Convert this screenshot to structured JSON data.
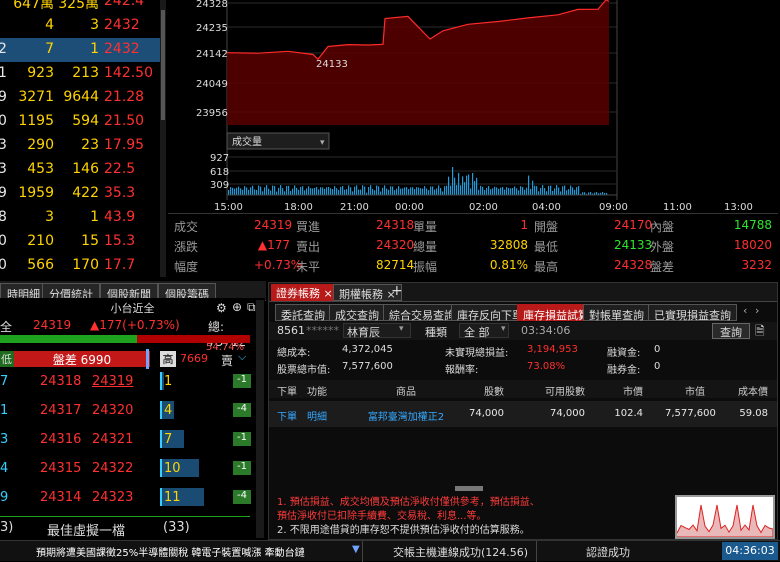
{
  "quotes": {
    "rows": [
      [
        "647萬",
        "325萬",
        "242.4"
      ],
      [
        "4",
        "3",
        "2432"
      ],
      [
        "7",
        "1",
        "2432"
      ],
      [
        "923",
        "213",
        "142.50"
      ],
      [
        "3271",
        "9644",
        "21.28"
      ],
      [
        "1195",
        "594",
        "21.50"
      ],
      [
        "290",
        "23",
        "17.95"
      ],
      [
        "453",
        "146",
        "22.5"
      ],
      [
        "1959",
        "422",
        "35.3"
      ],
      [
        "3",
        "1",
        "43.9"
      ],
      [
        "210",
        "15",
        "15.3"
      ],
      [
        "566",
        "170",
        "17.7"
      ]
    ],
    "prefix": [
      "",
      "",
      "2",
      "1",
      "9",
      "0",
      "3",
      "3",
      "9",
      "8",
      "0",
      "0"
    ],
    "selected_index": 2
  },
  "chart": {
    "y_ticks": [
      "24328",
      "24235",
      "24142",
      "24049",
      "23956"
    ],
    "low_label": "24133",
    "volume_select": "成交量",
    "vol_ticks": [
      "927",
      "618",
      "309"
    ],
    "x_ticks": [
      "15:00",
      "18:00",
      "21:00",
      "00:00",
      "02:00",
      "04:00",
      "09:00",
      "11:00",
      "13:00"
    ]
  },
  "stats": {
    "rows": [
      [
        {
          "t": "成交",
          "c": "gray"
        },
        {
          "t": "24319",
          "c": "r"
        },
        {
          "t": "買進",
          "c": "gray"
        },
        {
          "t": "24318",
          "c": "r"
        },
        {
          "t": "單量",
          "c": "gray"
        },
        {
          "t": "1",
          "c": "r"
        },
        {
          "t": "開盤",
          "c": "gray"
        },
        {
          "t": "24170",
          "c": "r"
        },
        {
          "t": "內盤",
          "c": "gray"
        },
        {
          "t": "14788",
          "c": "g"
        }
      ],
      [
        {
          "t": "漲跌",
          "c": "gray"
        },
        {
          "t": "▲177",
          "c": "r"
        },
        {
          "t": "賣出",
          "c": "gray"
        },
        {
          "t": "24320",
          "c": "r"
        },
        {
          "t": "總量",
          "c": "gray"
        },
        {
          "t": "32808",
          "c": "y"
        },
        {
          "t": "最低",
          "c": "gray"
        },
        {
          "t": "24133",
          "c": "g"
        },
        {
          "t": "外盤",
          "c": "gray"
        },
        {
          "t": "18020",
          "c": "r"
        }
      ],
      [
        {
          "t": "幅度",
          "c": "gray"
        },
        {
          "t": "+0.73%",
          "c": "r"
        },
        {
          "t": "未平",
          "c": "gray"
        },
        {
          "t": "82714",
          "c": "y"
        },
        {
          "t": "振幅",
          "c": "gray"
        },
        {
          "t": "0.81%",
          "c": "y"
        },
        {
          "t": "最高",
          "c": "gray"
        },
        {
          "t": "24328",
          "c": "r"
        },
        {
          "t": "盤差",
          "c": "gray"
        },
        {
          "t": "3232",
          "c": "r"
        }
      ]
    ]
  },
  "left_tabs": [
    "時明細",
    "分價統計",
    "個股新聞",
    "個股籌碼"
  ],
  "book": {
    "title": "小台近全",
    "sym_prefix": "全",
    "price": "24319",
    "change": "▲177(+0.73%)",
    "total_label": "總: 73712",
    "pct": "54.74%",
    "low_label": "低",
    "spread": "盤差 6990",
    "high_label": "高",
    "high_val": "7669",
    "sell_label": "賣",
    "rows": [
      [
        "7",
        "24318",
        "24319",
        "1",
        "-1"
      ],
      [
        "1",
        "24317",
        "24320",
        "4",
        "-4"
      ],
      [
        "3",
        "24316",
        "24321",
        "7",
        "-1"
      ],
      [
        "4",
        "24315",
        "24322",
        "10",
        "-1"
      ],
      [
        "9",
        "24314",
        "24323",
        "11",
        "-4"
      ]
    ],
    "footer_left": "3)",
    "footer_mid": "最佳虛擬一檔",
    "footer_right": "(33)"
  },
  "acct": {
    "tabs": [
      "證券帳務",
      "期權帳務"
    ],
    "subtabs": [
      "委託查詢",
      "成交查詢",
      "綜合交易查詢",
      "庫存反向下單",
      "庫存損益試算",
      "對帳單查詢",
      "已實現損益查詢"
    ],
    "active_subtab": 4,
    "account": "8561",
    "account_masked": "******",
    "name": "林育辰",
    "kind_label": "種類",
    "kind_value": "全 部",
    "time": "03:34:06",
    "query_btn": "查詢",
    "summary": [
      {
        "l": "總成本:",
        "v": "4,372,045",
        "l2": "未實現總損益:",
        "v2": "3,194,953",
        "l3": "融資金:",
        "v3": "0"
      },
      {
        "l": "股票總市值:",
        "v": "7,577,600",
        "l2": "報酬率:",
        "v2": "73.08%",
        "l3": "融券金:",
        "v3": "0"
      }
    ],
    "headers": [
      "下單",
      "功能",
      "商品",
      "股數",
      "可用股數",
      "市價",
      "市值",
      "成本價"
    ],
    "row": [
      "下單",
      "明細",
      "富邦臺灣加權正2",
      "74,000",
      "74,000",
      "102.4",
      "7,577,600",
      "59.08"
    ],
    "note1": "1. 預估損益、成交均價及預估淨收付僅供參考，預估損益、",
    "note2": "預估淨收付已扣除手續費、交易稅、利息...等。",
    "note3": "2. 不限用途借貸的庫存恕不提供預估淨收付的估算服務。"
  },
  "status": {
    "news": "預期將遭美國課徵25%半導體關稅 韓電子裝置喊漲 牽動台鏈",
    "conn": "交帳主機連線成功(124.56)",
    "auth": "認證成功",
    "time": "04:36:03"
  }
}
